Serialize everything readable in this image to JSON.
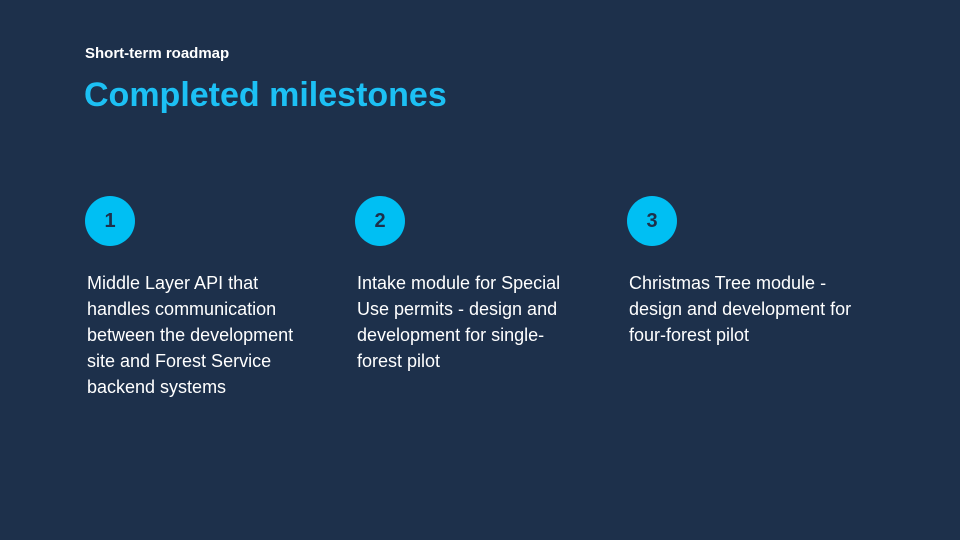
{
  "slide": {
    "kicker": "Short-term roadmap",
    "title": "Completed milestones",
    "accent_color": "#1cc0f4",
    "background_color": "#1d304b"
  },
  "milestones": [
    {
      "number": "1",
      "description": "Middle Layer API that handles communication between the development site and Forest Service backend systems"
    },
    {
      "number": "2",
      "description": "Intake module for Special Use permits - design and development for single-forest pilot"
    },
    {
      "number": "3",
      "description": "Christmas Tree module - design and development for four-forest pilot"
    }
  ]
}
